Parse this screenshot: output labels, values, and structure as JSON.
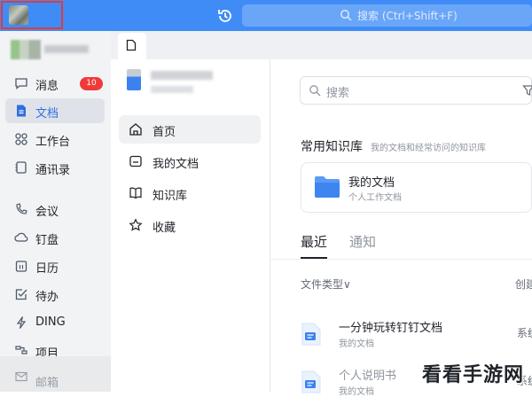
{
  "topbar": {
    "search_placeholder": "搜索 (Ctrl+Shift+F)"
  },
  "sidebar": {
    "badge": "10",
    "items": [
      {
        "label": "消息",
        "icon": "message-icon"
      },
      {
        "label": "文档",
        "icon": "document-icon",
        "active": true
      },
      {
        "label": "工作台",
        "icon": "workbench-icon"
      },
      {
        "label": "通讯录",
        "icon": "contacts-icon"
      },
      {
        "label": "会议",
        "icon": "meeting-icon"
      },
      {
        "label": "钉盘",
        "icon": "drive-icon"
      },
      {
        "label": "日历",
        "icon": "calendar-icon"
      },
      {
        "label": "待办",
        "icon": "todo-icon"
      },
      {
        "label": "DING",
        "icon": "ding-icon"
      },
      {
        "label": "项目",
        "icon": "project-icon"
      },
      {
        "label": "邮箱",
        "icon": "mail-icon"
      }
    ]
  },
  "docs_nav": {
    "items": [
      {
        "label": "首页",
        "icon": "home-icon",
        "active": true
      },
      {
        "label": "我的文档",
        "icon": "my-docs-icon"
      },
      {
        "label": "知识库",
        "icon": "knowledge-base-icon"
      },
      {
        "label": "收藏",
        "icon": "star-icon"
      }
    ]
  },
  "main": {
    "search_placeholder": "搜索",
    "kb_title": "常用知识库",
    "kb_subtitle": "我的文档和经常访问的知识库",
    "card": {
      "title": "我的文档",
      "subtitle": "个人工作文档"
    },
    "tabs": [
      "最近",
      "通知"
    ],
    "filter_label": "文件类型∨",
    "created_label": "创建",
    "files": [
      {
        "name": "一分钟玩转钉钉文档",
        "sub": "我的文档",
        "right": "系统"
      },
      {
        "name": "个人说明书",
        "sub": "我的文档",
        "right": "系统"
      }
    ]
  },
  "watermark": "看看手游网"
}
